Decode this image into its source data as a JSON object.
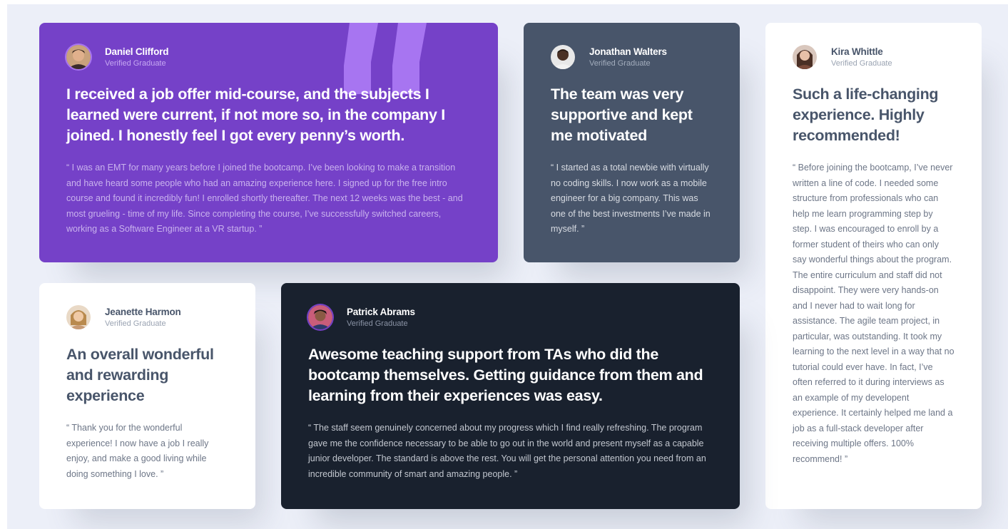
{
  "colors": {
    "purple": "#7541c8",
    "grey_blue": "#48556a",
    "dark_blue": "#19212e",
    "white": "#ffffff",
    "page_bg": "#eceff8",
    "quote_mark": "#a775f1"
  },
  "testimonials": [
    {
      "name": "Daniel Clifford",
      "role": "Verified Graduate",
      "headline": "I received a job offer mid-course, and the subjects I learned were current, if not more so, in the company I joined. I honestly feel I got every penny’s worth.",
      "body": "“ I was an EMT for many years before I joined the bootcamp. I’ve been looking to make a transition and have heard some people who had an amazing experience here. I signed up for the free intro course and found it incredibly fun! I enrolled shortly thereafter. The next 12 weeks was the  best - and most grueling - time of my life. Since completing the course, I’ve successfully switched careers, working as a Software Engineer at a VR startup. ”",
      "avatar_icon": "avatar-daniel-icon",
      "decoration_icon": "quotation-mark-icon"
    },
    {
      "name": "Jonathan Walters",
      "role": "Verified Graduate",
      "headline": "The team was very supportive and kept me motivated",
      "body": "“ I started as a total newbie with virtually no coding skills. I now work as a mobile engineer for a big company. This was one of the best investments I’ve made in myself. ”",
      "avatar_icon": "avatar-jonathan-icon"
    },
    {
      "name": "Kira Whittle",
      "role": "Verified Graduate",
      "headline": "Such a life-changing experience. Highly recommended!",
      "body": "“ Before joining the bootcamp, I’ve never written a line of code. I needed some structure from professionals who can help me learn programming step by step. I was encouraged to enroll by a former student of theirs who can only say wonderful things about the program. The entire curriculum and staff did not disappoint. They were very hands-on and I never had to wait long for assistance. The agile team project, in particular, was outstanding. It took my learning to the next level in a way that no tutorial could ever have. In fact, I’ve often referred to it during interviews as an example of my developent experience. It certainly helped me land a job as a full-stack developer after receiving multiple offers. 100% recommend! ”",
      "avatar_icon": "avatar-kira-icon"
    },
    {
      "name": "Jeanette Harmon",
      "role": "Verified Graduate",
      "headline": "An overall wonderful and rewarding experience",
      "body": "“ Thank you for the wonderful experience! I now have a job I really enjoy, and make a good living while doing something I love. ”",
      "avatar_icon": "avatar-jeanette-icon"
    },
    {
      "name": "Patrick Abrams",
      "role": "Verified Graduate",
      "headline": "Awesome teaching support from TAs who did the bootcamp themselves. Getting guidance from them and learning from their experiences was easy.",
      "body": "“ The staff seem genuinely concerned about my progress which I find really refreshing. The program gave me the confidence necessary to be able to go out in the world and present myself as a capable junior developer. The standard is above the rest. You will get the personal attention you need from an incredible community of smart and amazing people. ”",
      "avatar_icon": "avatar-patrick-icon"
    }
  ]
}
